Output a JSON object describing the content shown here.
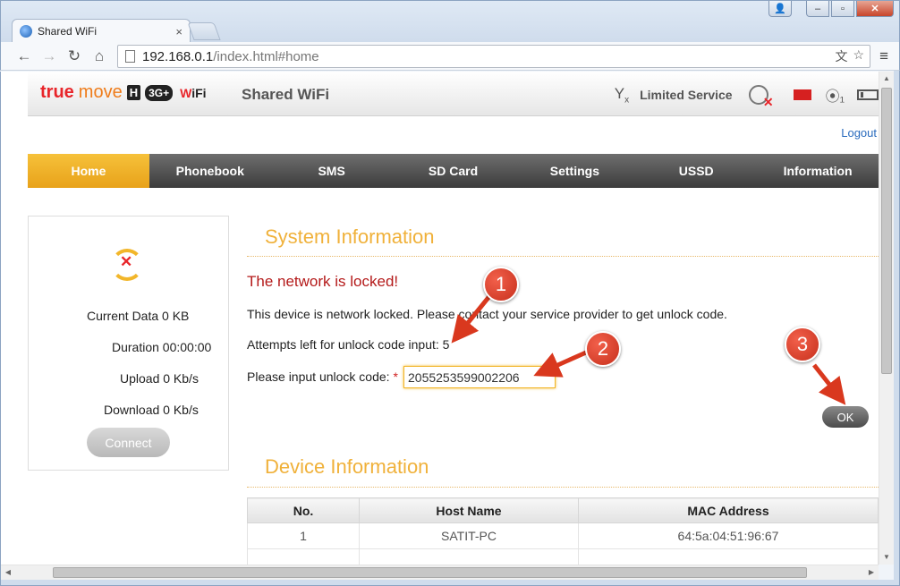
{
  "browser": {
    "tab_title": "Shared WiFi",
    "tab_close": "×",
    "url_host": "192.168.0.1",
    "url_path": "/index.html#home",
    "window_buttons": {
      "user": "👤",
      "minimize": "–",
      "maximize": "▫",
      "close": "✕"
    },
    "nav_icons": {
      "back": "←",
      "forward": "→",
      "reload": "↻",
      "home": "⌂",
      "translate": "文",
      "star": "☆",
      "menu": "≡"
    }
  },
  "header": {
    "brand_true": "true",
    "brand_move": "move",
    "brand_h": "H",
    "brand_3g": "3G+",
    "brand_wifi_w": "W",
    "brand_wifi_rest": "iFi",
    "site_title": "Shared WiFi",
    "signal_label": "Y",
    "signal_sub": "x",
    "status_text": "Limited Service",
    "wifi_symbol": "⦿₁"
  },
  "logout": "Logout",
  "nav": {
    "items": [
      "Home",
      "Phonebook",
      "SMS",
      "SD Card",
      "Settings",
      "USSD",
      "Information"
    ],
    "active_index": 0
  },
  "side_panel": {
    "sync_mark": "✕",
    "current_data": "Current Data 0 KB",
    "duration": "Duration 00:00:00",
    "upload": "Upload 0 Kb/s",
    "download": "Download 0 Kb/s",
    "connect_label": "Connect"
  },
  "system_info": {
    "title": "System Information",
    "lock_title": "The network is locked!",
    "lock_message": "This device is network locked. Please contact your service provider to get unlock code.",
    "attempts": "Attempts left for unlock code input: 5",
    "input_label": "Please input unlock code:",
    "required_mark": "*",
    "unlock_code": "2055253599002206",
    "ok_label": "OK"
  },
  "device_info": {
    "title": "Device Information",
    "columns": [
      "No.",
      "Host Name",
      "MAC Address"
    ],
    "rows": [
      [
        "1",
        "SATIT-PC",
        "64:5a:04:51:96:67"
      ],
      [
        "",
        "",
        ""
      ]
    ]
  },
  "annotations": {
    "labels": [
      "1",
      "2",
      "3"
    ],
    "color": "#d9381e"
  },
  "colors": {
    "accent_orange": "#f0b13a",
    "lock_red": "#b41a1a",
    "nav_dark": "#4a4a4a",
    "link_blue": "#2a6bbd"
  }
}
